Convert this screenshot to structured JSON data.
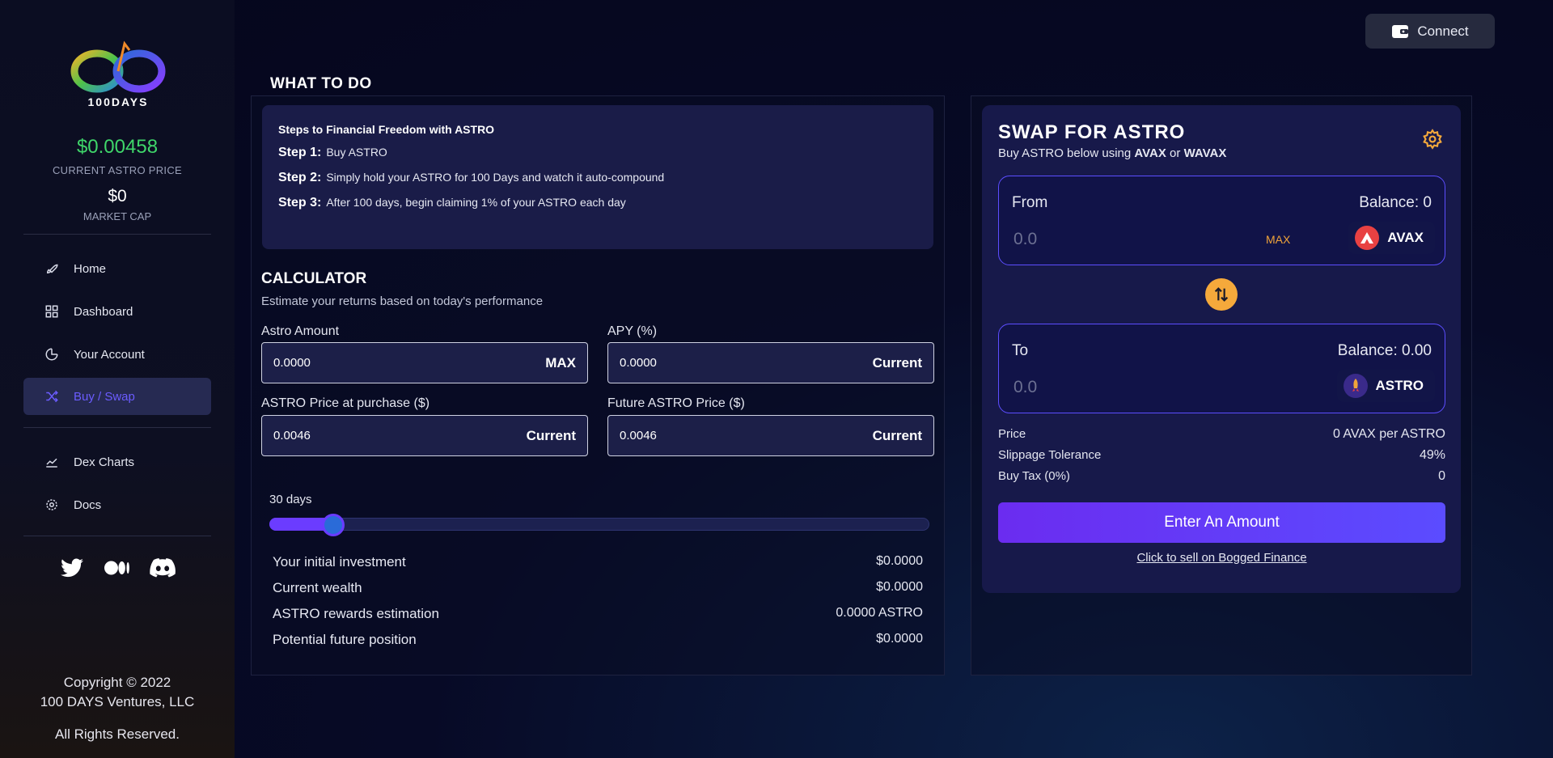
{
  "sidebar": {
    "logo_text": "100DAYS",
    "astro_price": "$0.00458",
    "astro_price_label": "CURRENT ASTRO PRICE",
    "market_cap": "$0",
    "market_cap_label": "MARKET CAP",
    "nav": [
      {
        "label": "Home",
        "icon": "rocket-icon"
      },
      {
        "label": "Dashboard",
        "icon": "grid-icon"
      },
      {
        "label": "Your Account",
        "icon": "pie-chart-icon"
      },
      {
        "label": "Buy / Swap",
        "icon": "shuffle-icon",
        "active": true
      },
      {
        "label": "Dex Charts",
        "icon": "line-chart-icon"
      },
      {
        "label": "Docs",
        "icon": "gear-icon"
      }
    ],
    "socials": [
      "twitter-icon",
      "medium-icon",
      "discord-icon"
    ],
    "copyright": [
      "Copyright © 2022",
      "100 DAYS Ventures, LLC",
      "All Rights Reserved."
    ]
  },
  "header": {
    "connect_label": "Connect"
  },
  "what_to_do": {
    "title": "WHAT TO DO",
    "heading": "Steps to Financial Freedom with ASTRO",
    "steps": [
      {
        "label": "Step 1:",
        "text": "Buy ASTRO"
      },
      {
        "label": "Step 2:",
        "text": "Simply hold your ASTRO for 100 Days and watch it auto-compound"
      },
      {
        "label": "Step 3:",
        "text": "After 100 days, begin claiming 1% of your ASTRO each day"
      }
    ]
  },
  "calculator": {
    "title": "CALCULATOR",
    "subtitle": "Estimate your returns based on today's performance",
    "fields": {
      "astro_amount": {
        "label": "Astro Amount",
        "value": "0.0000",
        "button": "MAX"
      },
      "apy": {
        "label": "APY (%)",
        "value": "0.0000",
        "button": "Current"
      },
      "purchase_price": {
        "label": "ASTRO Price at purchase ($)",
        "value": "0.0046",
        "button": "Current"
      },
      "future_price": {
        "label": "Future ASTRO Price ($)",
        "value": "0.0046",
        "button": "Current"
      }
    },
    "days_label": "30 days",
    "days_fraction": 0.08,
    "results": [
      {
        "label": "Your initial investment",
        "value": "$0.0000"
      },
      {
        "label": "Current wealth",
        "value": "$0.0000"
      },
      {
        "label": "ASTRO rewards estimation",
        "value": "0.0000 ASTRO"
      },
      {
        "label": "Potential future position",
        "value": "$0.0000"
      }
    ]
  },
  "swap": {
    "title": "SWAP FOR ASTRO",
    "subtitle_prefix": "Buy ASTRO below using ",
    "token_a": "AVAX",
    "subtitle_or": " or ",
    "token_b": "WAVAX",
    "from": {
      "label": "From",
      "balance": "Balance: 0",
      "amount_placeholder": "0.0",
      "max": "MAX",
      "token": "AVAX"
    },
    "to": {
      "label": "To",
      "balance": "Balance: 0.00",
      "amount_placeholder": "0.0",
      "token": "ASTRO"
    },
    "info": [
      {
        "label": "Price",
        "value": "0 AVAX per ASTRO"
      },
      {
        "label": "Slippage Tolerance",
        "value": "49%"
      },
      {
        "label": "Buy Tax (0%)",
        "value": "0"
      }
    ],
    "enter_button": "Enter An Amount",
    "sell_link": "Click to sell on Bogged Finance"
  },
  "colors": {
    "accent": "#6b3cff",
    "price_green": "#3fd66a",
    "swap_orange": "#f5a93b"
  }
}
